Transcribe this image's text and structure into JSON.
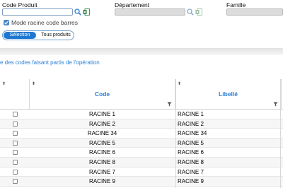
{
  "filters": {
    "code_produit_label": "Code Produit",
    "code_produit_value": "",
    "departement_label": "Département",
    "departement_value": "",
    "famille_label": "Famille",
    "famille_value": "",
    "mode_racine_label": "Mode racine code barres",
    "mode_racine_checked": true,
    "toggle_selection": "Sélection",
    "toggle_all": "Tous produits"
  },
  "section_title": "e des codes faisant partis de l'opération",
  "grid": {
    "sort_glyph": "⬍",
    "columns": [
      "Code",
      "Libellé"
    ],
    "rows": [
      {
        "code": "RACINE 1",
        "libelle": "RACINE 1"
      },
      {
        "code": "RACINE 2",
        "libelle": "RACINE 2"
      },
      {
        "code": "RACINE 34",
        "libelle": "RACINE 34"
      },
      {
        "code": "RACINE 5",
        "libelle": "RACINE 5"
      },
      {
        "code": "RACINE 6",
        "libelle": "RACINE 6"
      },
      {
        "code": "RACINE 8",
        "libelle": "RACINE 8"
      },
      {
        "code": "RACINE 7",
        "libelle": "RACINE 7"
      },
      {
        "code": "RACINE 9",
        "libelle": "RACINE 9"
      }
    ]
  },
  "icons": {
    "search": "search-icon",
    "excel": "excel-icon",
    "filter": "filter-icon"
  },
  "colors": {
    "accent": "#2b7fd4",
    "toggle_active": "#1e78d2",
    "excel_green": "#1f7a3c"
  }
}
